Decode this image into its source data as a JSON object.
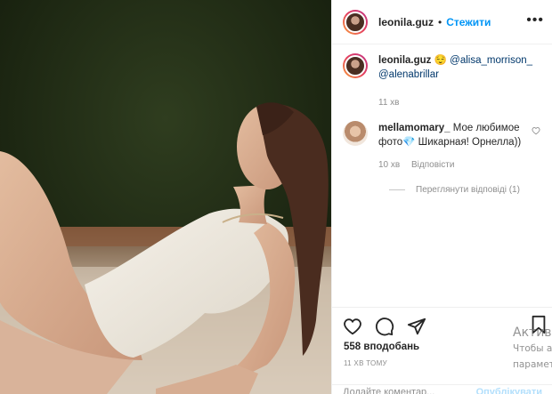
{
  "post": {
    "username": "leonila.guz",
    "separator": "•",
    "follow_label": "Стежити",
    "more_icon": "more-options-icon"
  },
  "caption": {
    "username": "leonila.guz",
    "emoji": "😌",
    "mention1": "@alisa_morrison_",
    "mention2": "@alenabrillar",
    "time": "11 хв"
  },
  "comment": {
    "username": "mellamomary_",
    "text": "Мое любимое фото💎 Шикарная! Орнелла))",
    "time": "10 хв",
    "reply_label": "Відповісти",
    "view_replies": "Переглянути відповіді (1)"
  },
  "actions": {
    "likes": "558 вподобань",
    "timestamp": "11 ХВ ТОМУ",
    "add_comment_placeholder": "Додайте коментар...",
    "publish_label": "Опублікувати"
  },
  "windows_watermark": {
    "title": "Актива",
    "line1": "Чтобы а",
    "line2": "парамет"
  },
  "colors": {
    "accent": "#0095f6",
    "text": "#262626",
    "muted": "#8e8e8e"
  }
}
